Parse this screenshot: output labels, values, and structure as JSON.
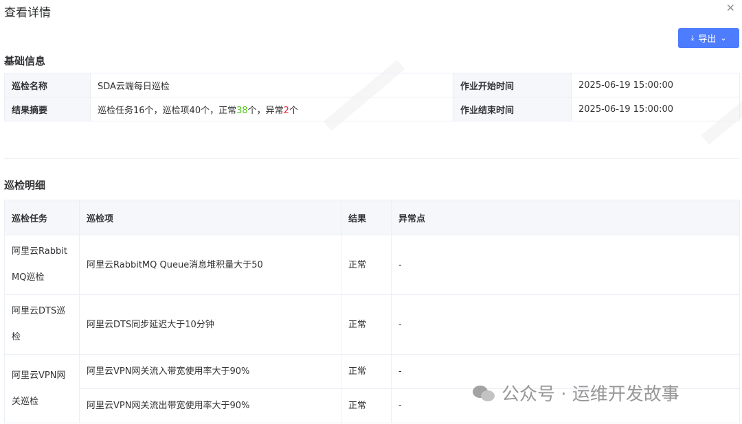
{
  "dialog": {
    "title": "查看详情",
    "close_icon": "close-icon"
  },
  "toolbar": {
    "export_label": "导出",
    "export_icon": "download-icon",
    "dropdown_icon": "chevron-down-icon"
  },
  "basic_info": {
    "title": "基础信息",
    "rows": [
      {
        "label1": "巡检名称",
        "value1": "SDA云端每日巡检",
        "label2": "作业开始时间",
        "value2": "2025-06-19 15:00:00"
      },
      {
        "label1": "结果摘要",
        "label2": "作业结束时间",
        "value2": "2025-06-19 15:00:00"
      }
    ],
    "summary": {
      "part1": "巡检任务16个，巡检项40个，正常",
      "normal_count": "38",
      "part2": "个，异常",
      "abnormal_count": "2",
      "part3": "个"
    }
  },
  "detail": {
    "title": "巡检明细",
    "headers": [
      "巡检任务",
      "巡检项",
      "结果",
      "异常点"
    ],
    "rows": [
      {
        "task": "阿里云RabbitMQ巡检",
        "item": "阿里云RabbitMQ Queue消息堆积量大于50",
        "result": "正常",
        "anomaly": "-"
      },
      {
        "task": "阿里云DTS巡检",
        "item": "阿里云DTS同步延迟大于10分钟",
        "result": "正常",
        "anomaly": "-"
      },
      {
        "task": "阿里云VPN网关巡检",
        "item": "阿里云VPN网关流入带宽使用率大于90%",
        "result": "正常",
        "anomaly": "-"
      },
      {
        "item": "阿里云VPN网关流出带宽使用率大于90%",
        "result": "正常",
        "anomaly": "-"
      }
    ]
  },
  "watermark": {
    "text": "公众号 · 运维开发故事",
    "icon": "wechat-icon"
  },
  "colors": {
    "primary": "#4d7cfe",
    "normal": "#52c41a",
    "abnormal": "#f5222d",
    "header_bg": "#f5f7fa",
    "border": "#ebeef5"
  }
}
